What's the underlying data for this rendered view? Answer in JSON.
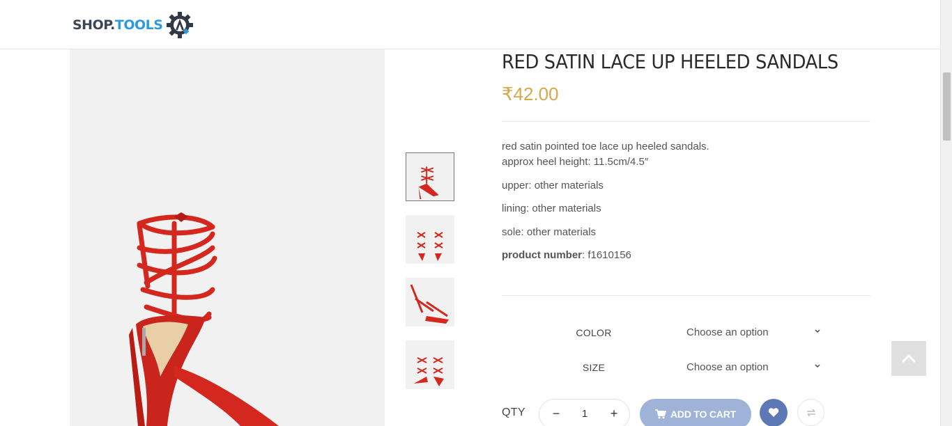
{
  "header": {
    "logo_part1": "SHOP.",
    "logo_part2": "TOOLS",
    "logo_icon": "gear-a-icon"
  },
  "product": {
    "title": "RED SATIN LACE UP HEELED SANDALS",
    "price": "₹42.00",
    "description_line1": "red satin pointed toe lace up heeled sandals.",
    "description_line2": "approx heel height: 11.5cm/4.5″",
    "upper": "upper: other materials",
    "lining": "lining: other materials",
    "sole": "sole: other materials",
    "product_number_label": "product number",
    "product_number_value": ": f1610156"
  },
  "variations": {
    "color_label": "COLOR",
    "color_value": "Choose an option",
    "size_label": "SIZE",
    "size_value": "Choose an option"
  },
  "cart": {
    "qty_label": "QTY",
    "qty_value": "1",
    "minus": "−",
    "plus": "+",
    "add_to_cart": "ADD TO CART"
  },
  "colors": {
    "price": "#d4a84b",
    "cart_button": "#9fb3d9",
    "wishlist_button": "#5c79b5",
    "shoe_red": "#d4271e"
  }
}
